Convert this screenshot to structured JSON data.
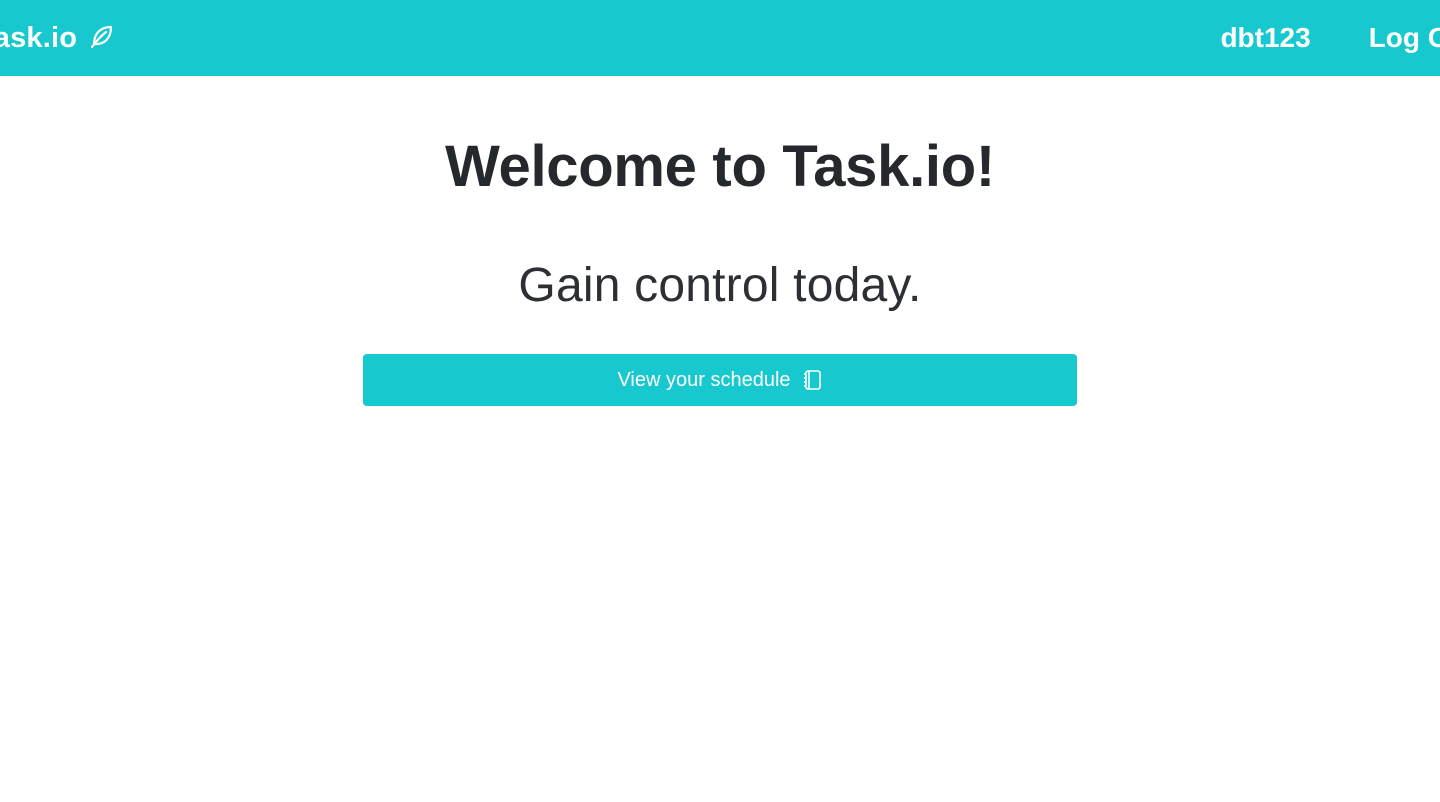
{
  "navbar": {
    "brand_label": "Task.io",
    "brand_icon": "leaf-icon",
    "username": "dbt123",
    "logout_label": "Log Out"
  },
  "main": {
    "title": "Welcome to Task.io!",
    "subtitle": "Gain control today.",
    "cta_label": "View your schedule",
    "cta_icon": "notebook-icon"
  },
  "colors": {
    "accent": "#17c8cf",
    "text": "#25282c",
    "background": "#ffffff"
  }
}
